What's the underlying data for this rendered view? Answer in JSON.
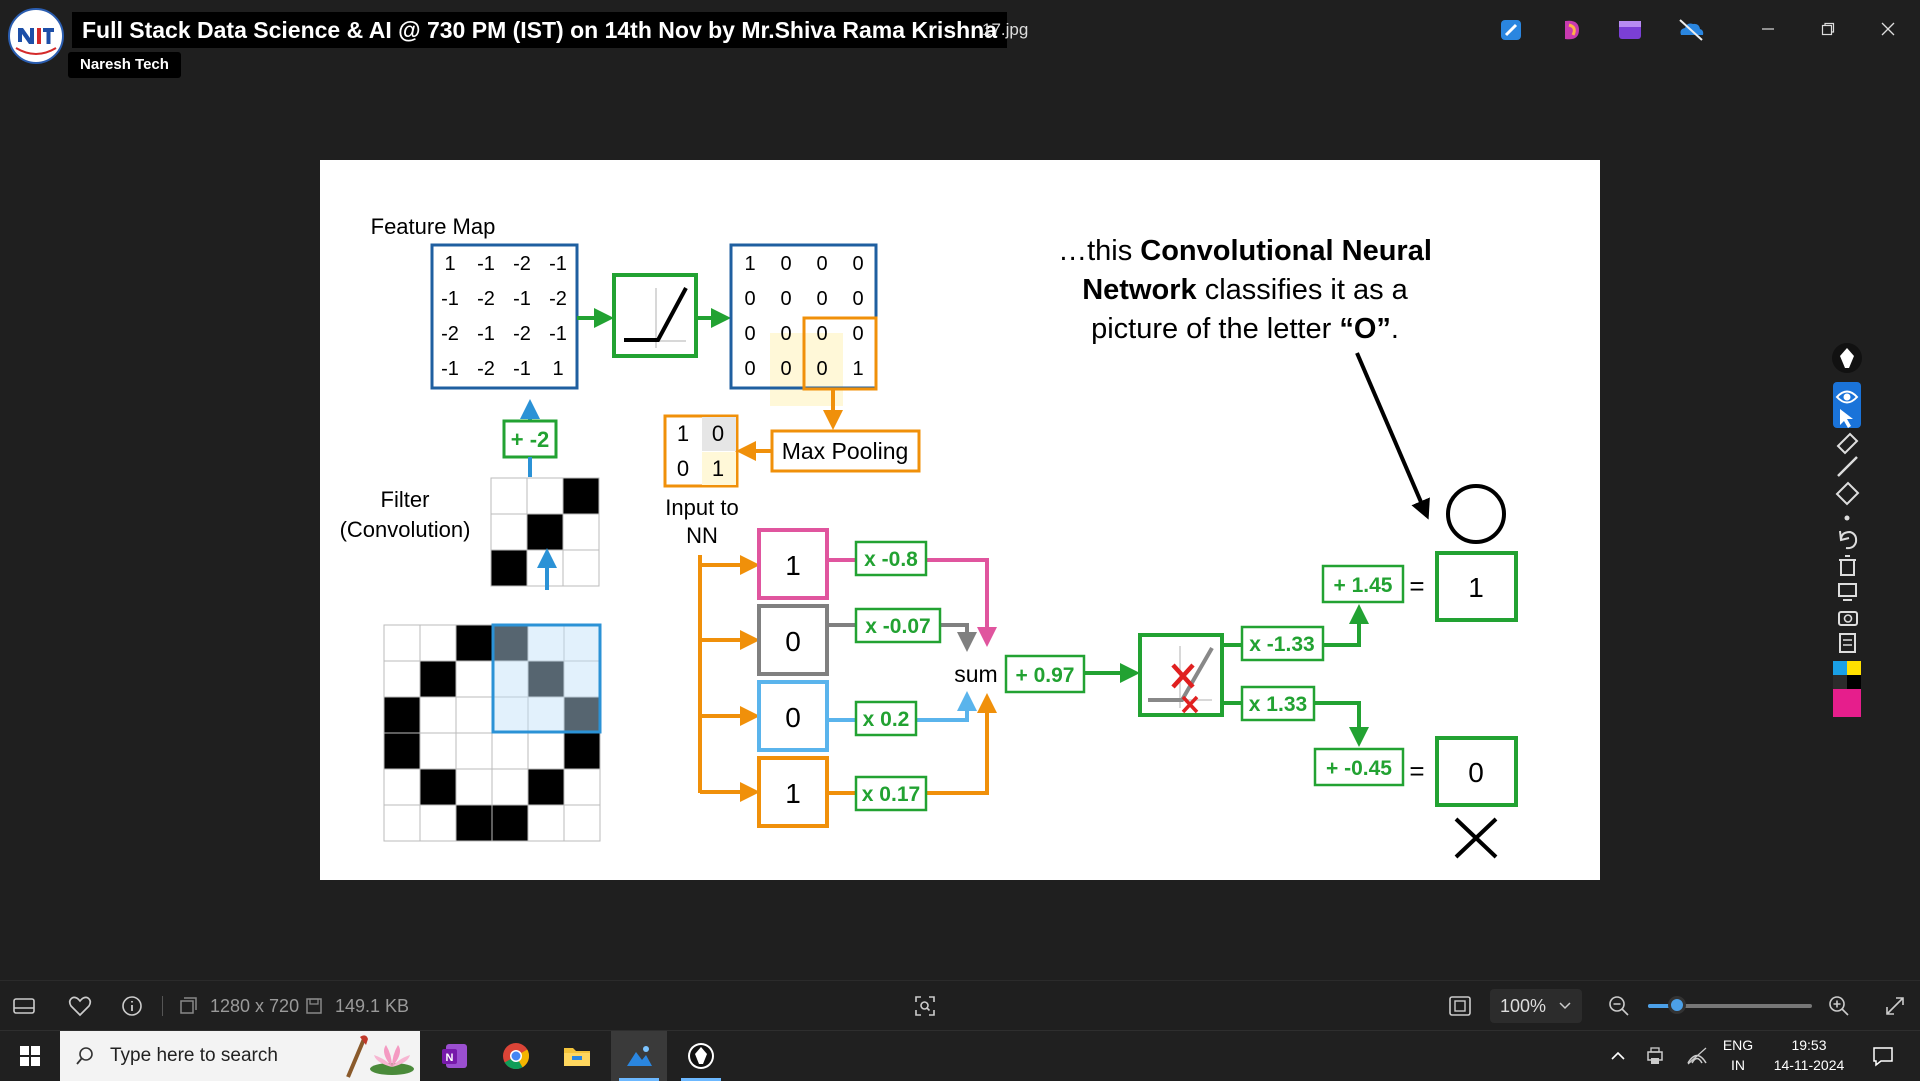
{
  "window": {
    "video_title": "Full Stack Data Science & AI @ 730 PM (IST) on 14th Nov by Mr.Shiva Rama Krishna",
    "channel_name": "Naresh Tech",
    "filename_fragment": "17.jpg"
  },
  "slide": {
    "feature_map_label": "Feature Map",
    "feature_map": [
      [
        "1",
        "-1",
        "-2",
        "-1"
      ],
      [
        "-1",
        "-2",
        "-1",
        "-2"
      ],
      [
        "-2",
        "-1",
        "-2",
        "-1"
      ],
      [
        "-1",
        "-2",
        "-1",
        "1"
      ]
    ],
    "relu_output": [
      [
        "1",
        "0",
        "0",
        "0"
      ],
      [
        "0",
        "0",
        "0",
        "0"
      ],
      [
        "0",
        "0",
        "0",
        "0"
      ],
      [
        "0",
        "0",
        "0",
        "1"
      ]
    ],
    "bias_label": "+ -2",
    "filter_label_1": "Filter",
    "filter_label_2": "(Convolution)",
    "max_pooling_label": "Max Pooling",
    "pooled": [
      [
        "1",
        "0"
      ],
      [
        "0",
        "1"
      ]
    ],
    "input_label_1": "Input to",
    "input_label_2": "NN",
    "inputs": [
      "1",
      "0",
      "0",
      "1"
    ],
    "weights": [
      "x -0.8",
      "x -0.07",
      "x 0.2",
      "x 0.17"
    ],
    "sum_label": "sum",
    "sum_bias": "+ 0.97",
    "out_weight_1": "x -1.33",
    "out_weight_2": "x 1.33",
    "out_bias_1": "+ 1.45",
    "out_bias_2": "+ -0.45",
    "equals": "=",
    "output_1": "1",
    "output_2": "0",
    "caption_1_prefix": "…this ",
    "caption_1_bold": "Convolutional Neural",
    "caption_2_bold": "Network",
    "caption_2_rest": " classifies it as a",
    "caption_3_prefix": "picture of the letter ",
    "caption_3_bold": "“O”",
    "caption_3_suffix": "."
  },
  "statusbar": {
    "dimensions": "1280 x 720",
    "file_size": "149.1 KB",
    "zoom": "100%"
  },
  "taskbar": {
    "search_placeholder": "Type here to search",
    "language_1": "ENG",
    "language_2": "IN",
    "time": "19:53",
    "date": "14-11-2024"
  }
}
